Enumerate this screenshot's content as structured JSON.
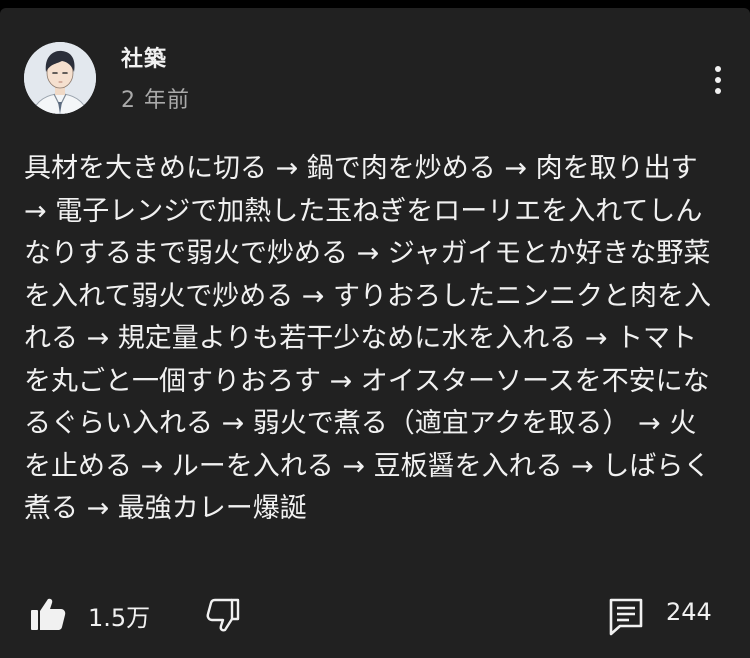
{
  "comment": {
    "author": "社築",
    "time": "2 年前",
    "text": "具材を大きめに切る → 鍋で肉を炒める → 肉を取り出す → 電子レンジで加熱した玉ねぎをローリエを入れてしんなりするまで弱火で炒める → ジャガイモとか好きな野菜を入れて弱火で炒める → すりおろしたニンニクと肉を入れる → 規定量よりも若干少なめに水を入れる → トマトを丸ごと一個すりおろす → オイスターソースを不安になるぐらい入れる → 弱火で煮る（適宜アクを取る） → 火を止める → ルーを入れる → 豆板醤を入れる → しばらく煮る → 最強カレー爆誕"
  },
  "actions": {
    "like_count": "1.5万",
    "reply_count": "244"
  },
  "icons": {
    "avatar": "avatar",
    "more": "more-vert-icon",
    "like": "thumbs-up-icon",
    "dislike": "thumbs-down-icon",
    "reply": "comment-icon"
  },
  "colors": {
    "background": "#212121",
    "text": "#f1f1f1",
    "secondary_text": "#aaaaaa"
  }
}
